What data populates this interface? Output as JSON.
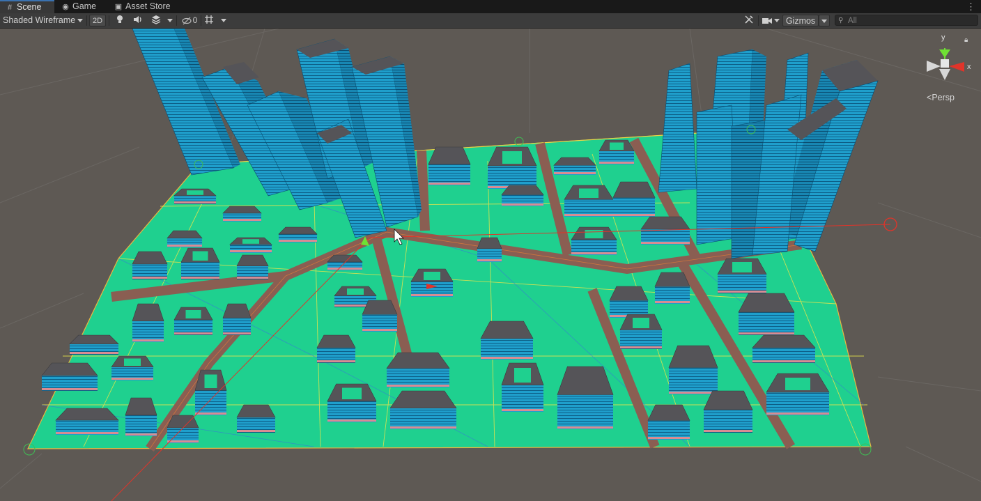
{
  "tabs": [
    {
      "label": "Scene",
      "icon": "hash-icon"
    },
    {
      "label": "Game",
      "icon": "gamepad-icon"
    },
    {
      "label": "Asset Store",
      "icon": "bag-icon"
    }
  ],
  "toolbar": {
    "draw_mode": "Shaded Wireframe",
    "toggle_2d": "2D",
    "hidden_count": "0",
    "gizmos": "Gizmos",
    "search_placeholder": "All"
  },
  "gizmo": {
    "y_label": "y",
    "x_label": "x",
    "projection": "Persp"
  },
  "colors": {
    "ground": "#1fd08f",
    "road": "#8a5e52",
    "building_side": "#1f9fcc",
    "roof": "#555458",
    "accent_band": "#d88c92",
    "axis_x": "#e0342a",
    "axis_y": "#6fe033"
  }
}
